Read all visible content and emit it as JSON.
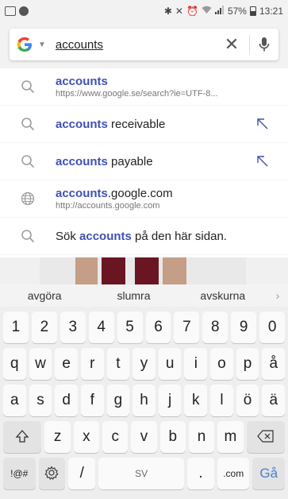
{
  "status_bar": {
    "time": "13:21",
    "battery": "57%"
  },
  "search": {
    "query": "accounts",
    "logo": "G",
    "clear_icon": "close-icon",
    "mic_icon": "mic-icon"
  },
  "suggestions": [
    {
      "type": "search",
      "bold": "accounts",
      "rest": "",
      "sub": "https://www.google.se/search?ie=UTF-8..."
    },
    {
      "type": "query",
      "bold": "accounts",
      "rest": " receivable",
      "sub": ""
    },
    {
      "type": "query",
      "bold": "accounts",
      "rest": " payable",
      "sub": ""
    },
    {
      "type": "web",
      "bold": "accounts",
      "rest": ".google.com",
      "sub": "http://accounts.google.com"
    },
    {
      "type": "search",
      "prefix": "Sök ",
      "bold": "accounts",
      "rest": " på den här sidan.",
      "sub": ""
    }
  ],
  "keyboard": {
    "predictions": [
      "avgöra",
      "slumra",
      "avskurna"
    ],
    "row_numbers": [
      "1",
      "2",
      "3",
      "4",
      "5",
      "6",
      "7",
      "8",
      "9",
      "0"
    ],
    "row1": [
      "q",
      "w",
      "e",
      "r",
      "t",
      "y",
      "u",
      "i",
      "o",
      "p",
      "å"
    ],
    "row2": [
      "a",
      "s",
      "d",
      "f",
      "g",
      "h",
      "j",
      "k",
      "l",
      "ö",
      "ä"
    ],
    "row3": [
      "z",
      "x",
      "c",
      "v",
      "b",
      "n",
      "m"
    ],
    "symbols_label": "!@#",
    "slash_label": "/",
    "space_label": "SV",
    "period_label": ".",
    "dotcom_label": ".com",
    "go_label": "Gå"
  },
  "colors": {
    "highlight": "#3f51b5",
    "google_blue": "#4285f4"
  }
}
